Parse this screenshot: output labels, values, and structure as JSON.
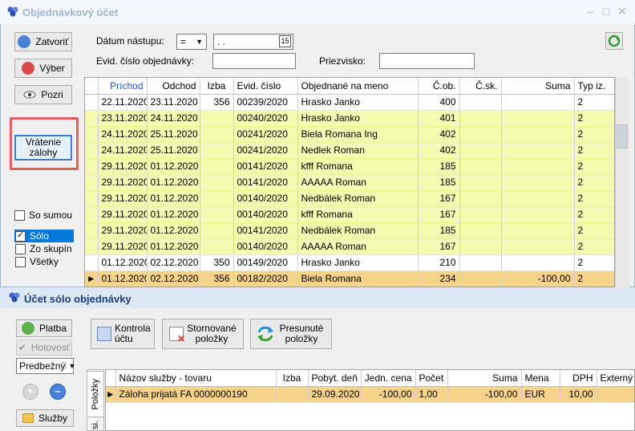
{
  "window1": {
    "title": "Objednávkový účet",
    "controls": {
      "minimize": "–",
      "maximize": "□",
      "close": "✕"
    }
  },
  "sidebar": {
    "close_label": "Zatvoriť",
    "select_label": "Výber",
    "look_label": "Pozri",
    "return_deposit_label": "Vrátenie zálohy",
    "with_sum_label": "So sumou",
    "options": [
      {
        "label": "Sólo",
        "checked": true
      },
      {
        "label": "Zo skupín",
        "checked": false
      },
      {
        "label": "Všetky",
        "checked": false
      }
    ]
  },
  "filters": {
    "arrival_label": "Dátum nástupu:",
    "operator_value": "=",
    "date_value": " .  .",
    "calendar_label": "15",
    "order_no_label": "Evid. číslo objednávky:",
    "order_no_value": "",
    "surname_label": "Priezvisko:",
    "surname_value": ""
  },
  "orders": {
    "columns": [
      "Príchod",
      "Odchod",
      "Izba",
      "Evid. číslo",
      "Objednané na meno",
      "Č.ob.",
      "Č.sk.",
      "Suma",
      "Typ iz."
    ],
    "rows": [
      {
        "arr": "22.11.2020",
        "dep": "23.11.2020",
        "room": "356",
        "ev": "00239/2020",
        "name": "Hrasko Janko",
        "ob": "400",
        "sk": "",
        "sum": "",
        "typ": "2",
        "style": "white"
      },
      {
        "arr": "23.11.2020",
        "dep": "24.11.2020",
        "room": "",
        "ev": "00240/2020",
        "name": "Hrasko Janko",
        "ob": "401",
        "sk": "",
        "sum": "",
        "typ": "2",
        "style": "yellow"
      },
      {
        "arr": "24.11.2020",
        "dep": "25.11.2020",
        "room": "",
        "ev": "00241/2020",
        "name": "Biela Romana Ing",
        "ob": "402",
        "sk": "",
        "sum": "",
        "typ": "2",
        "style": "yellow"
      },
      {
        "arr": "24.11.2020",
        "dep": "25.11.2020",
        "room": "",
        "ev": "00241/2020",
        "name": "Nedlek Roman",
        "ob": "402",
        "sk": "",
        "sum": "",
        "typ": "2",
        "style": "yellow"
      },
      {
        "arr": "29.11.2020",
        "dep": "01.12.2020",
        "room": "",
        "ev": "00141/2020",
        "name": "kfff Romana",
        "ob": "185",
        "sk": "",
        "sum": "",
        "typ": "2",
        "style": "yellow"
      },
      {
        "arr": "29.11.2020",
        "dep": "01.12.2020",
        "room": "",
        "ev": "00141/2020",
        "name": "AAAAA Roman",
        "ob": "185",
        "sk": "",
        "sum": "",
        "typ": "2",
        "style": "yellow"
      },
      {
        "arr": "29.11.2020",
        "dep": "01.12.2020",
        "room": "",
        "ev": "00140/2020",
        "name": "Nedbálek Roman",
        "ob": "167",
        "sk": "",
        "sum": "",
        "typ": "2",
        "style": "yellow"
      },
      {
        "arr": "29.11.2020",
        "dep": "01.12.2020",
        "room": "",
        "ev": "00140/2020",
        "name": "kfff Romana",
        "ob": "167",
        "sk": "",
        "sum": "",
        "typ": "2",
        "style": "yellow"
      },
      {
        "arr": "29.11.2020",
        "dep": "01.12.2020",
        "room": "",
        "ev": "00141/2020",
        "name": "Nedbálek Roman",
        "ob": "185",
        "sk": "",
        "sum": "",
        "typ": "2",
        "style": "yellow"
      },
      {
        "arr": "29.11.2020",
        "dep": "01.12.2020",
        "room": "",
        "ev": "00140/2020",
        "name": "AAAAA Roman",
        "ob": "167",
        "sk": "",
        "sum": "",
        "typ": "2",
        "style": "yellow"
      },
      {
        "arr": "01.12.2020",
        "dep": "02.12.2020",
        "room": "350",
        "ev": "00149/2020",
        "name": "Hrasko Janko",
        "ob": "210",
        "sk": "",
        "sum": "",
        "typ": "2",
        "style": "white"
      },
      {
        "arr": "01.12.2020",
        "dep": "02.12.2020",
        "room": "356",
        "ev": "00182/2020",
        "name": "Biela Romana",
        "ob": "234",
        "sk": "",
        "sum": "-100,00",
        "typ": "2",
        "style": "sel"
      }
    ]
  },
  "window2": {
    "title": "Účet sólo objednávky",
    "pay_label": "Platba",
    "cash_label": "Hotovosť",
    "mode_value": "Predbežný",
    "services_label": "Služby",
    "tool_check": "Kontrola účtu",
    "tool_cancelled": "Stornované položky",
    "tool_moved": "Presunuté položky",
    "tab_items": "Položky",
    "tab_other": "si."
  },
  "items": {
    "columns": [
      "Názov služby - tovaru",
      "Izba",
      "Pobyt. deň",
      "Jedn. cena",
      "Počet",
      "Suma",
      "Mena",
      "DPH",
      "Externý"
    ],
    "rows": [
      {
        "name": "Záloha prijatá FA 0000000190",
        "room": "",
        "day": "29.09.2020",
        "unit": "-100,00",
        "count": "1,00",
        "sum": "-100,00",
        "cur": "EUR",
        "vat": "10,00",
        "ext": ""
      }
    ]
  }
}
